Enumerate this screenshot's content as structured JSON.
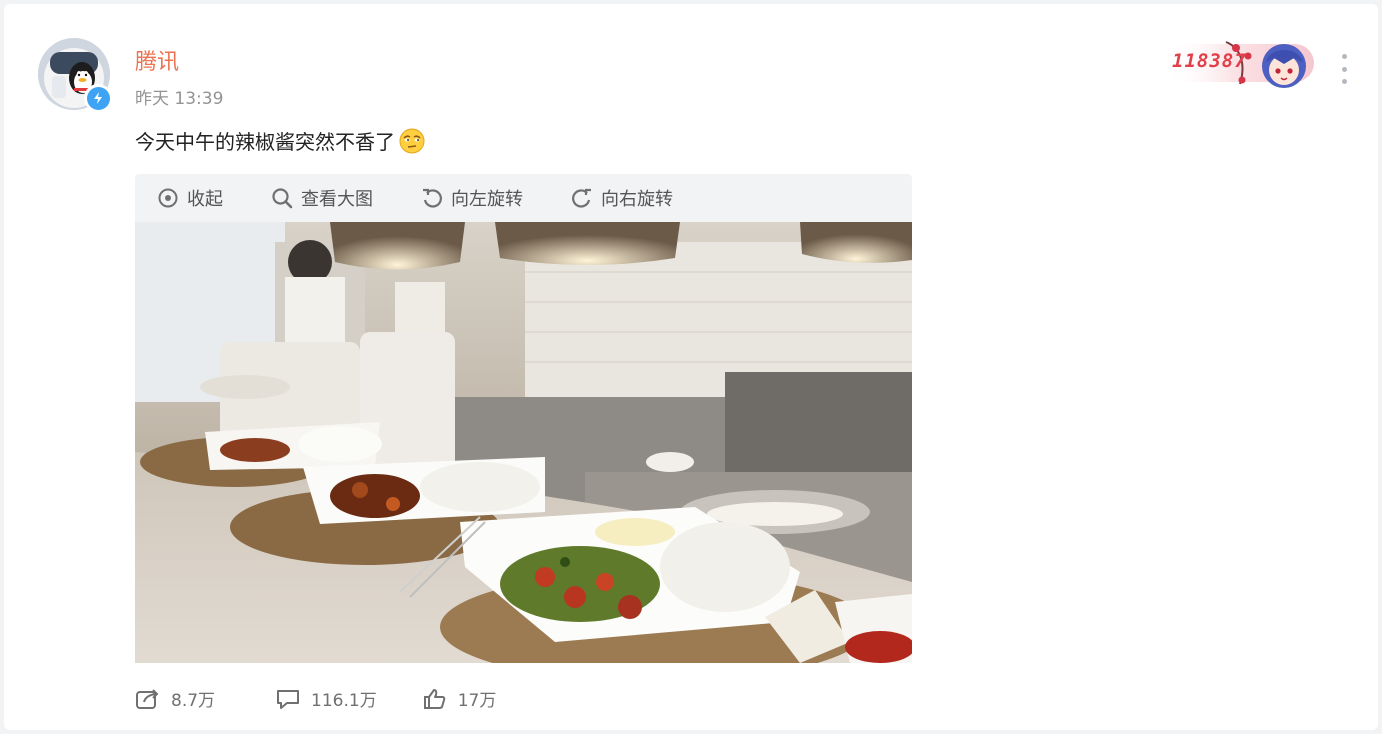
{
  "post": {
    "author": "腾讯",
    "time": "昨天 13:39",
    "text": "今天中午的辣椒酱突然不香了",
    "badge_number": "118387"
  },
  "image_toolbar": {
    "collapse": "收起",
    "view_large": "查看大图",
    "rotate_left": "向左旋转",
    "rotate_right": "向右旋转"
  },
  "stats": {
    "reposts": "8.7万",
    "comments": "116.1万",
    "likes": "17万"
  },
  "icons": [
    "verified-icon",
    "more-icon",
    "collapse-icon",
    "zoom-icon",
    "rotate-left-icon",
    "rotate-right-icon",
    "repost-icon",
    "comment-icon",
    "like-icon"
  ],
  "colors": {
    "author": "#eb7350",
    "verified": "#3ea3f5",
    "badge": "#e0404a"
  }
}
